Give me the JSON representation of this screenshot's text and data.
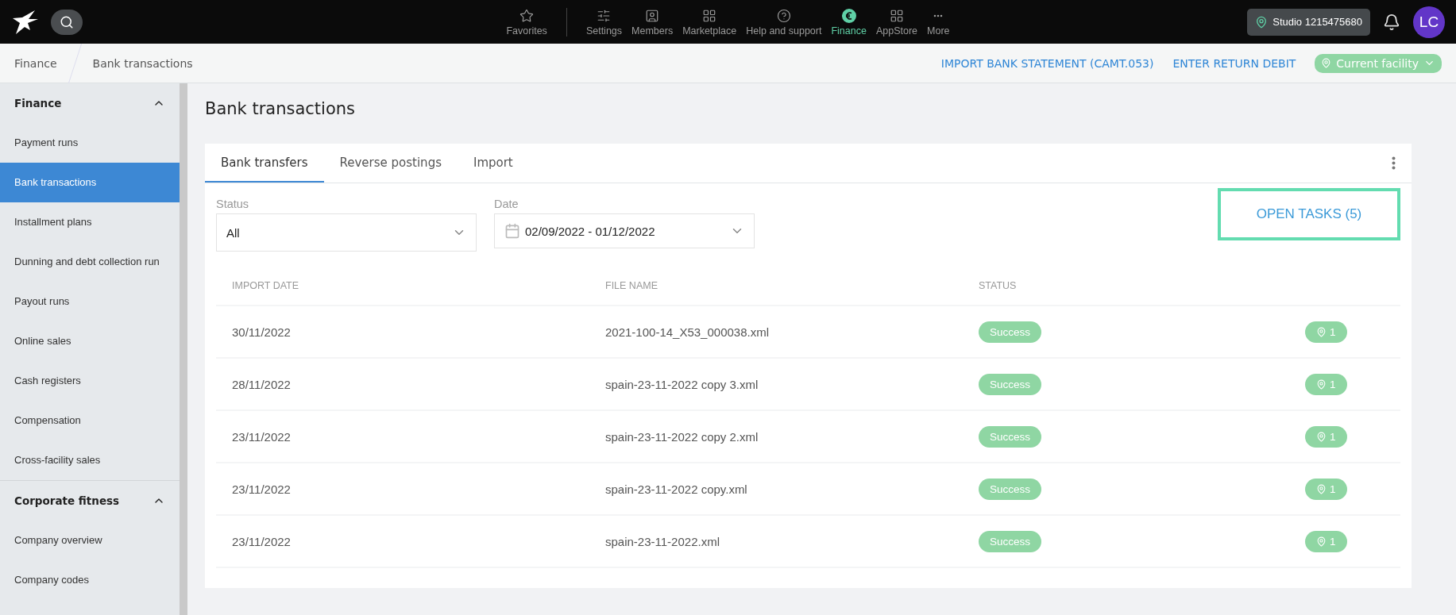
{
  "top_bar": {
    "nav": [
      {
        "label": "Favorites",
        "kind": "star",
        "selected": false
      },
      {
        "label": "Settings",
        "kind": "sliders",
        "selected": false
      },
      {
        "label": "Members",
        "kind": "members",
        "selected": false
      },
      {
        "label": "Marketplace",
        "kind": "grid",
        "selected": false
      },
      {
        "label": "Help and support",
        "kind": "help",
        "selected": false
      },
      {
        "label": "Finance",
        "kind": "euro",
        "selected": true
      },
      {
        "label": "AppStore",
        "kind": "grid",
        "selected": false
      },
      {
        "label": "More",
        "kind": "more",
        "selected": false
      }
    ],
    "studio": "Studio 1215475680",
    "avatar": "LC"
  },
  "breadcrumb": [
    "Finance",
    "Bank transactions"
  ],
  "actions": [
    "IMPORT BANK STATEMENT (CAMT.053)",
    "ENTER RETURN DEBIT"
  ],
  "facility": "Current facility",
  "sidebar": [
    {
      "title": "Finance",
      "expanded": true,
      "items": [
        {
          "label": "Payment runs",
          "selected": false
        },
        {
          "label": "Bank transactions",
          "selected": true
        },
        {
          "label": "Installment plans",
          "selected": false
        },
        {
          "label": "Dunning and debt collection run",
          "selected": false
        },
        {
          "label": "Payout runs",
          "selected": false
        },
        {
          "label": "Online sales",
          "selected": false
        },
        {
          "label": "Cash registers",
          "selected": false
        },
        {
          "label": "Compensation",
          "selected": false
        },
        {
          "label": "Cross-facility sales",
          "selected": false
        }
      ]
    },
    {
      "title": "Corporate fitness",
      "expanded": true,
      "items": [
        {
          "label": "Company overview",
          "selected": false
        },
        {
          "label": "Company codes",
          "selected": false
        }
      ]
    }
  ],
  "page_title": "Bank transactions",
  "tabs": [
    {
      "label": "Bank transfers",
      "selected": true
    },
    {
      "label": "Reverse postings",
      "selected": false
    },
    {
      "label": "Import",
      "selected": false
    }
  ],
  "filters": {
    "status": {
      "label": "Status",
      "value": "All"
    },
    "date": {
      "label": "Date",
      "value": "02/09/2022 - 01/12/2022"
    }
  },
  "open_tasks": "OPEN TASKS (5)",
  "table": {
    "columns": [
      "IMPORT DATE",
      "FILE NAME",
      "STATUS"
    ],
    "rows": [
      {
        "date": "30/11/2022",
        "file": "2021-100-14_X53_000038.xml",
        "status": "Success",
        "count": "1"
      },
      {
        "date": "28/11/2022",
        "file": "spain-23-11-2022 copy 3.xml",
        "status": "Success",
        "count": "1"
      },
      {
        "date": "23/11/2022",
        "file": "spain-23-11-2022 copy 2.xml",
        "status": "Success",
        "count": "1"
      },
      {
        "date": "23/11/2022",
        "file": "spain-23-11-2022 copy.xml",
        "status": "Success",
        "count": "1"
      },
      {
        "date": "23/11/2022",
        "file": "spain-23-11-2022.xml",
        "status": "Success",
        "count": "1"
      }
    ]
  }
}
